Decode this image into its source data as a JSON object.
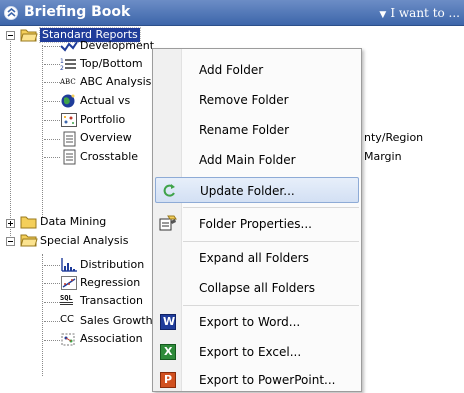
{
  "header": {
    "title": "Briefing Book",
    "menu_label": "I want to ..."
  },
  "tree": {
    "root": {
      "label": "Standard Reports",
      "children": [
        "Development",
        "Top/Bottom",
        "ABC Analysis",
        "Actual vs",
        "Portfolio",
        "Overview",
        "Crosstable"
      ],
      "behind_menu": [
        "nty/Region",
        "Margin"
      ]
    },
    "data_mining": "Data Mining",
    "special": {
      "label": "Special Analysis",
      "children": [
        "Distribution",
        "Regression",
        "Transaction",
        "Sales Growth",
        "Association"
      ]
    }
  },
  "context_menu": {
    "items": [
      {
        "label": "Add Folder"
      },
      {
        "label": "Remove Folder"
      },
      {
        "label": "Rename Folder"
      },
      {
        "label": "Add Main Folder"
      },
      {
        "label": "Update Folder..."
      },
      {
        "label": "Folder Properties..."
      },
      {
        "label": "Expand all Folders"
      },
      {
        "label": "Collapse all Folders"
      },
      {
        "label": "Export to Word..."
      },
      {
        "label": "Export to Excel..."
      },
      {
        "label": "Export to PowerPoint..."
      }
    ],
    "highlighted": "Update Folder..."
  },
  "icon_glyphs": {
    "abc": "ABC",
    "cc": "CC",
    "sql": "SQL",
    "word": "W",
    "excel": "X",
    "powerpoint": "P"
  }
}
